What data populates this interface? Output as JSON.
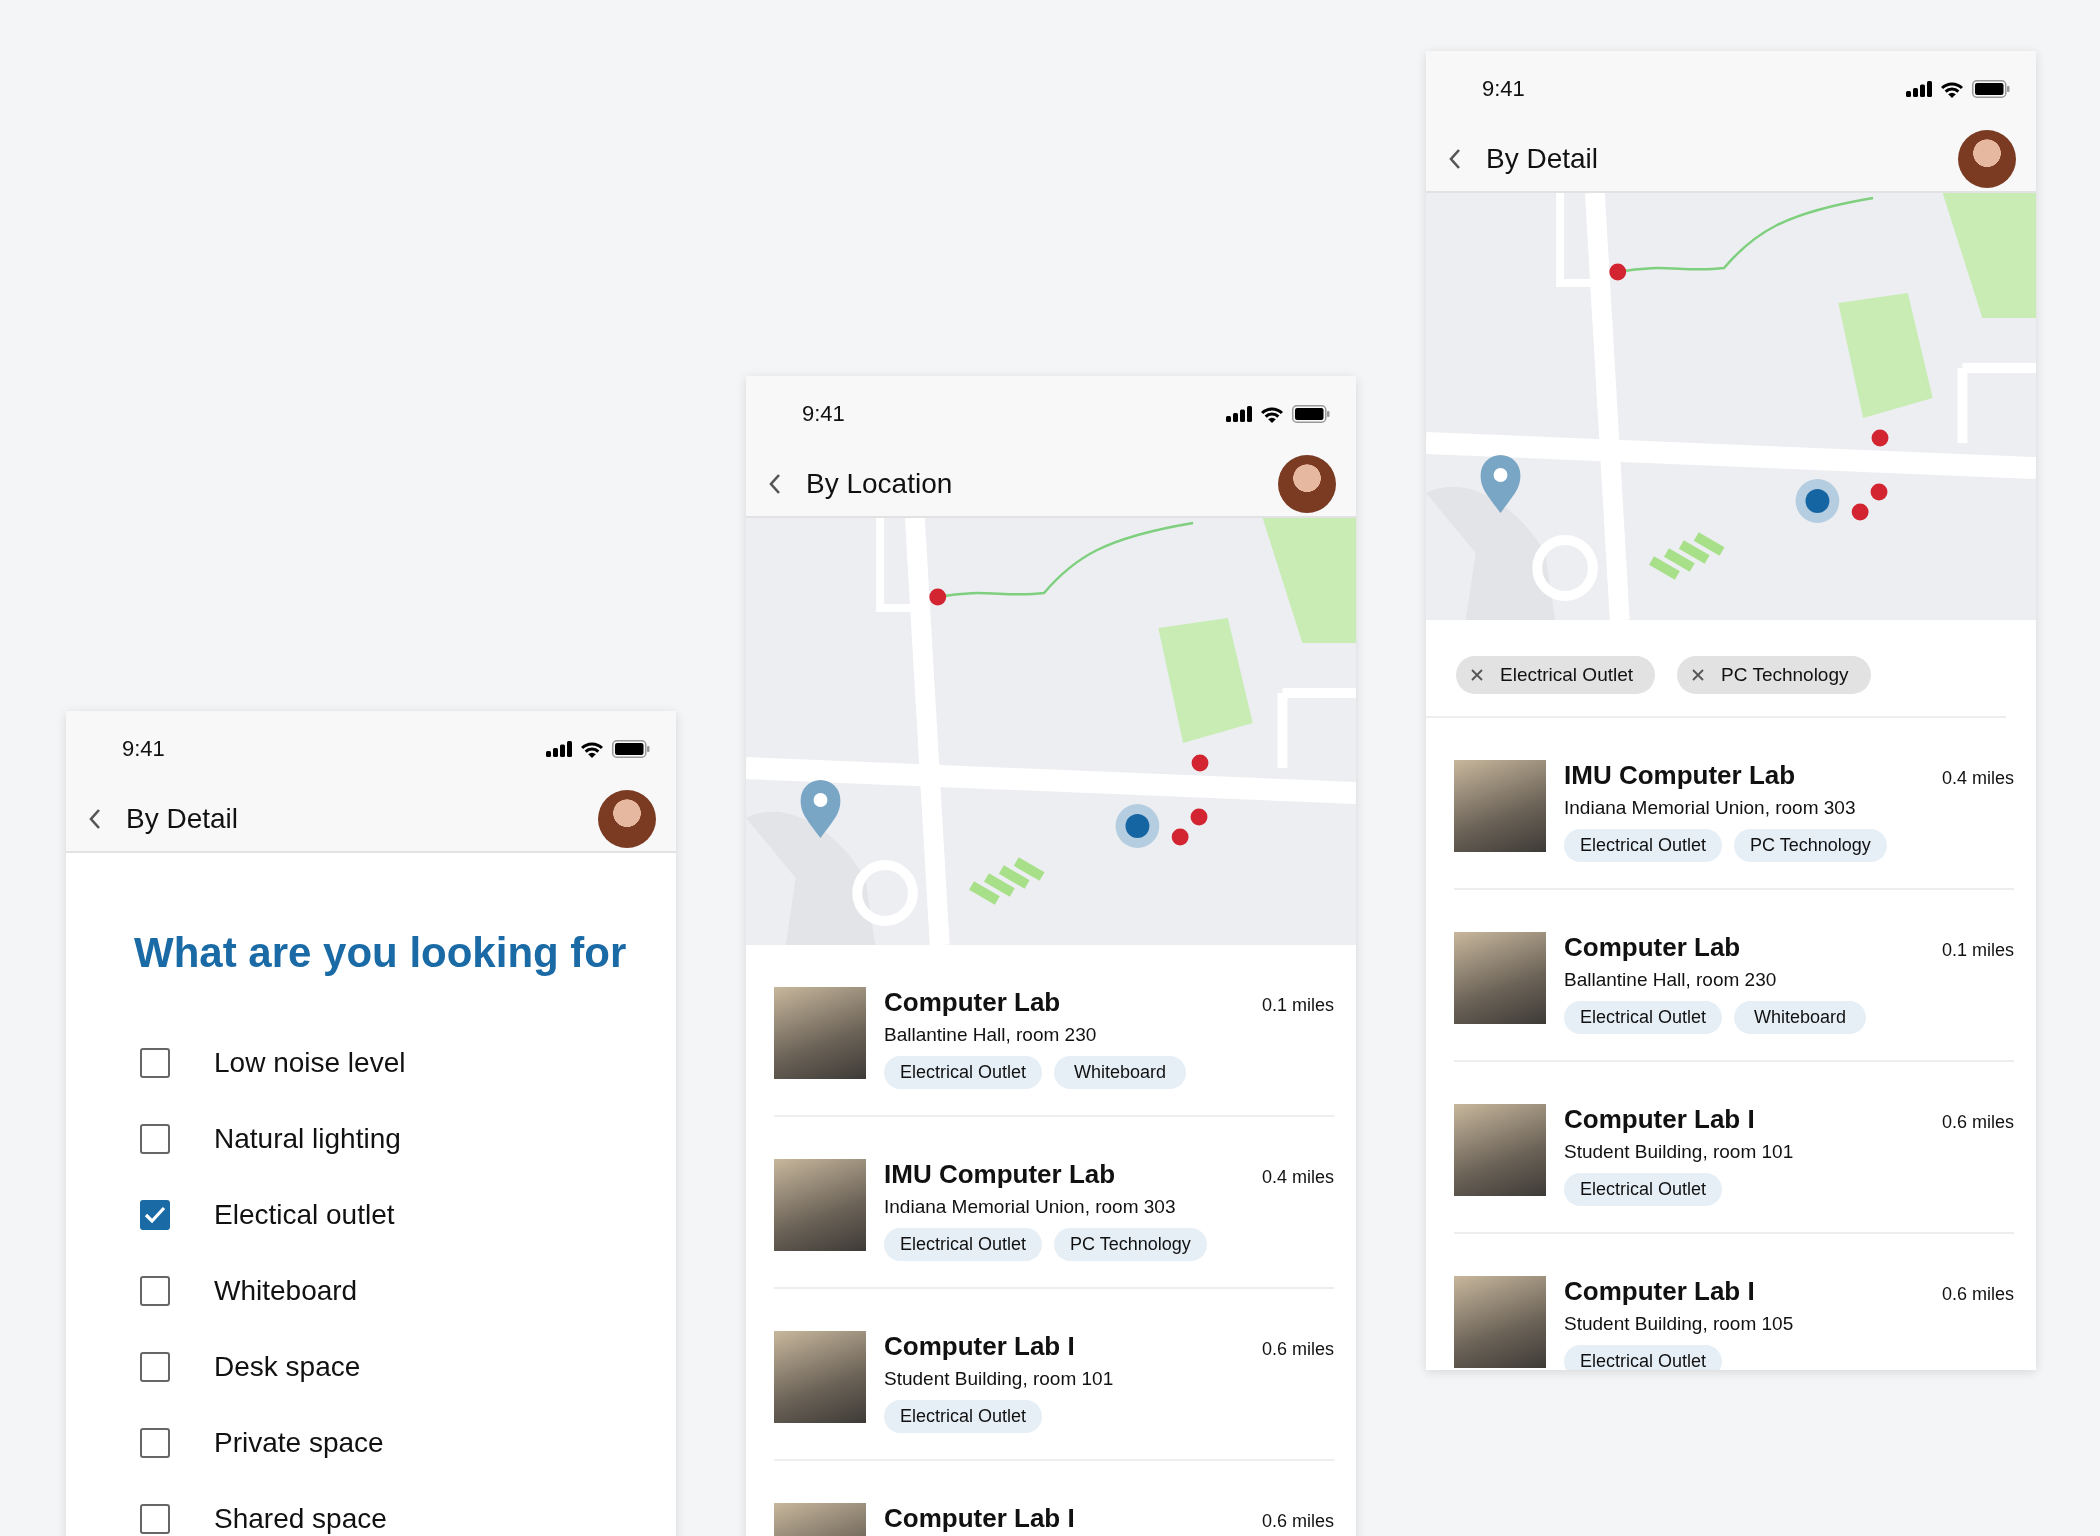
{
  "screens": [
    {
      "kind": "filters",
      "time": "9:41",
      "title": "By Detail",
      "heading": "What are you looking for",
      "options": [
        {
          "label": "Low noise level",
          "checked": false
        },
        {
          "label": "Natural lighting",
          "checked": false
        },
        {
          "label": "Electical outlet",
          "checked": true
        },
        {
          "label": "Whiteboard",
          "checked": false
        },
        {
          "label": "Desk space",
          "checked": false
        },
        {
          "label": "Private space",
          "checked": false
        },
        {
          "label": "Shared space",
          "checked": false
        }
      ]
    },
    {
      "kind": "location",
      "time": "9:41",
      "title": "By Location",
      "results": [
        {
          "name": "Computer Lab",
          "address": "Ballantine Hall, room 230",
          "distance": "0.1 miles",
          "tags": [
            "Electrical Outlet",
            "Whiteboard"
          ]
        },
        {
          "name": "IMU Computer Lab",
          "address": "Indiana Memorial Union, room 303",
          "distance": "0.4 miles",
          "tags": [
            "Electrical Outlet",
            "PC Technology"
          ]
        },
        {
          "name": "Computer Lab I",
          "address": "Student Building, room 101",
          "distance": "0.6 miles",
          "tags": [
            "Electrical Outlet"
          ]
        },
        {
          "name": "Computer Lab I",
          "distance": "0.6 miles"
        }
      ]
    },
    {
      "kind": "results",
      "time": "9:41",
      "title": "By Detail",
      "active_filters": [
        "Electrical Outlet",
        "PC Technology"
      ],
      "results": [
        {
          "name": "IMU Computer Lab",
          "address": "Indiana Memorial Union, room 303",
          "distance": "0.4 miles",
          "tags": [
            "Electrical Outlet",
            "PC Technology"
          ]
        },
        {
          "name": "Computer Lab",
          "address": "Ballantine Hall, room 230",
          "distance": "0.1 miles",
          "tags": [
            "Electrical Outlet",
            "Whiteboard"
          ]
        },
        {
          "name": "Computer Lab I",
          "address": "Student Building, room 101",
          "distance": "0.6 miles",
          "tags": [
            "Electrical Outlet"
          ]
        },
        {
          "name": "Computer Lab I",
          "address": "Student Building, room 105",
          "distance": "0.6 miles",
          "tags": [
            "Electrical Outlet"
          ]
        }
      ]
    }
  ]
}
